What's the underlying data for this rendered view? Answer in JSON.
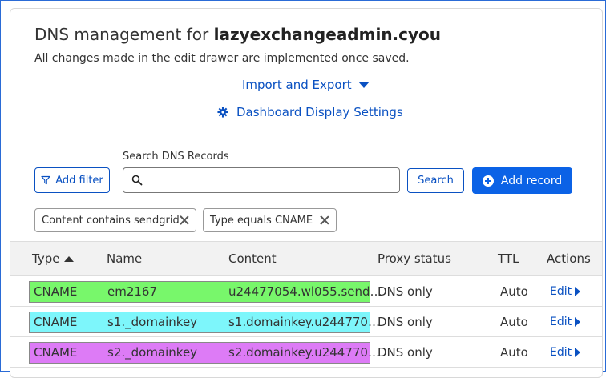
{
  "header": {
    "title_prefix": "DNS management for ",
    "domain": "lazyexchangeadmin.cyou",
    "subtitle": "All changes made in the edit drawer are implemented once saved."
  },
  "links": {
    "import_export": "Import and Export",
    "dashboard_settings": "Dashboard Display Settings"
  },
  "search": {
    "label": "Search DNS Records",
    "placeholder": "",
    "value": "",
    "button": "Search"
  },
  "buttons": {
    "add_filter": "Add filter",
    "add_record": "Add record"
  },
  "filters": [
    {
      "label": "Content contains sendgrid"
    },
    {
      "label": "Type equals CNAME"
    }
  ],
  "table": {
    "columns": [
      "Type",
      "Name",
      "Content",
      "Proxy status",
      "TTL",
      "Actions"
    ],
    "rows": [
      {
        "type": "CNAME",
        "name": "em2167",
        "content": "u24477054.wl055.send…",
        "proxy": "DNS only",
        "ttl": "Auto",
        "action": "Edit",
        "highlight": "#78f76b"
      },
      {
        "type": "CNAME",
        "name": "s1._domainkey",
        "content": "s1.domainkey.u244770…",
        "proxy": "DNS only",
        "ttl": "Auto",
        "action": "Edit",
        "highlight": "#7df6fb"
      },
      {
        "type": "CNAME",
        "name": "s2._domainkey",
        "content": "s2.domainkey.u244770…",
        "proxy": "DNS only",
        "ttl": "Auto",
        "action": "Edit",
        "highlight": "#dd7bf6"
      }
    ]
  },
  "colors": {
    "accent": "#0a51c2",
    "primary_button": "#0b62e6"
  }
}
